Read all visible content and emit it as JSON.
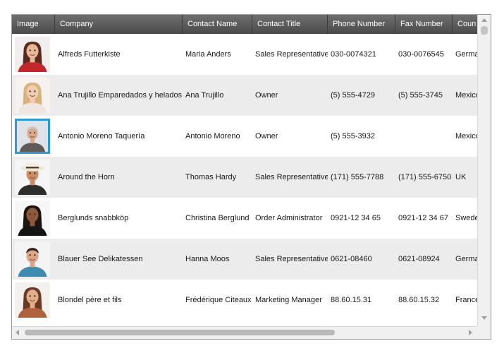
{
  "columns": [
    "Image",
    "Company",
    "Contact Name",
    "Contact Title",
    "Phone Number",
    "Fax Number",
    "Coun"
  ],
  "rows": [
    {
      "avatar": "woman-red-jacket",
      "company": "Alfreds Futterkiste",
      "contact": "Maria Anders",
      "title": "Sales Representative",
      "phone": "030-0074321",
      "fax": "030-0076545",
      "country": "Germa"
    },
    {
      "avatar": "woman-blonde",
      "company": "Ana Trujillo Emparedados y helados",
      "contact": "Ana Trujillo",
      "title": "Owner",
      "phone": "(5) 555-4729",
      "fax": "(5) 555-3745",
      "country": "Mexico"
    },
    {
      "avatar": "man-older",
      "company": "Antonio Moreno Taquería",
      "contact": "Antonio Moreno",
      "title": "Owner",
      "phone": "(5) 555-3932",
      "fax": "",
      "country": "Mexico",
      "selected": true
    },
    {
      "avatar": "man-hat",
      "company": "Around the Horn",
      "contact": "Thomas Hardy",
      "title": "Sales Representative",
      "phone": "(171) 555-7788",
      "fax": "(171) 555-6750",
      "country": "UK"
    },
    {
      "avatar": "woman-curly",
      "company": "Berglunds snabbköp",
      "contact": "Christina Berglund",
      "title": "Order Administrator",
      "phone": "0921-12 34 65",
      "fax": "0921-12 34 67",
      "country": "Swede"
    },
    {
      "avatar": "woman-short-hair",
      "company": "Blauer See Delikatessen",
      "contact": "Hanna Moos",
      "title": "Sales Representative",
      "phone": "0621-08460",
      "fax": "0621-08924",
      "country": "Germa"
    },
    {
      "avatar": "woman-long-hair",
      "company": "Blondel père et fils",
      "contact": "Frédérique Citeaux",
      "title": "Marketing Manager",
      "phone": "88.60.15.31",
      "fax": "88.60.15.32",
      "country": "France"
    }
  ],
  "colors": {
    "header": "#5a5a5a",
    "alt_row": "#ececec",
    "selection": "#2e9bd6"
  }
}
